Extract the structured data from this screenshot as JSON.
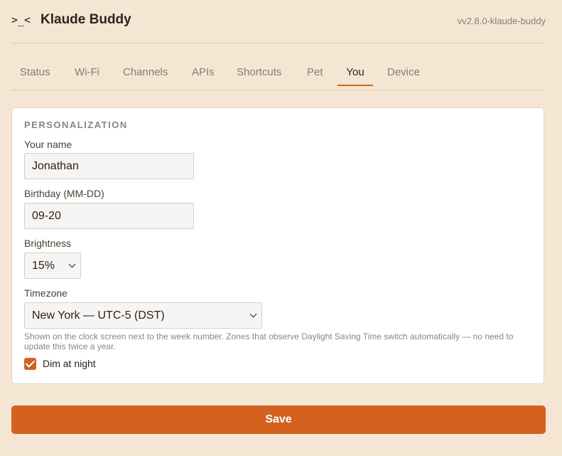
{
  "header": {
    "logo": ">_<",
    "title": "Klaude Buddy",
    "version": "vv2.8.0-klaude-buddy"
  },
  "tabs": [
    {
      "label": "Status",
      "active": false
    },
    {
      "label": "Wi-Fi",
      "active": false
    },
    {
      "label": "Channels",
      "active": false
    },
    {
      "label": "APIs",
      "active": false
    },
    {
      "label": "Shortcuts",
      "active": false
    },
    {
      "label": "Pet",
      "active": false
    },
    {
      "label": "You",
      "active": true
    },
    {
      "label": "Device",
      "active": false
    }
  ],
  "personalization": {
    "section_title": "PERSONALIZATION",
    "name": {
      "label": "Your name",
      "value": "Jonathan"
    },
    "birthday": {
      "label": "Birthday (MM-DD)",
      "value": "09-20"
    },
    "brightness": {
      "label": "Brightness",
      "value": "15%"
    },
    "timezone": {
      "label": "Timezone",
      "value": "New York — UTC-5 (DST)",
      "help": "Shown on the clock screen next to the week number. Zones that observe Daylight Saving Time switch automatically — no need to update this twice a year."
    },
    "dim_at_night": {
      "label": "Dim at night",
      "checked": true
    }
  },
  "actions": {
    "save_label": "Save"
  },
  "colors": {
    "background": "#f5e6d3",
    "accent": "#d4611e",
    "card": "#ffffff"
  }
}
